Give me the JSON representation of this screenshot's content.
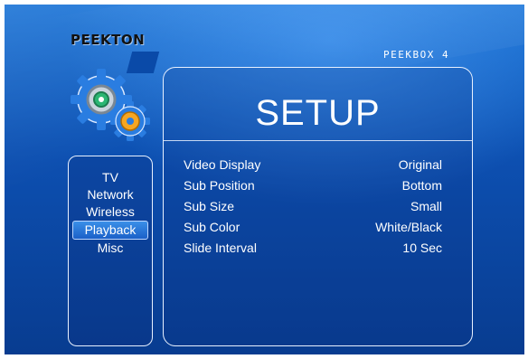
{
  "brand": {
    "logo_text": "PEEKTON",
    "model": "PEEKBOX 4"
  },
  "emblem": {
    "icon": "settings-gears-icon",
    "colors": [
      "#2a7de1",
      "#7a8794",
      "#f5a623",
      "#2bb673"
    ]
  },
  "title": "SETUP",
  "side_menu": {
    "items": [
      {
        "label": "TV"
      },
      {
        "label": "Network"
      },
      {
        "label": "Wireless"
      },
      {
        "label": "Playback",
        "selected": true
      },
      {
        "label": "Misc"
      }
    ]
  },
  "settings": [
    {
      "label": "Video Display",
      "value": "Original"
    },
    {
      "label": "Sub Position",
      "value": "Bottom"
    },
    {
      "label": "Sub Size",
      "value": "Small"
    },
    {
      "label": "Sub Color",
      "value": "White/Black"
    },
    {
      "label": "Slide Interval",
      "value": "10 Sec"
    }
  ],
  "colors": {
    "background": "#0d4fb0",
    "highlight": "#2a7de1",
    "text": "#ffffff"
  }
}
